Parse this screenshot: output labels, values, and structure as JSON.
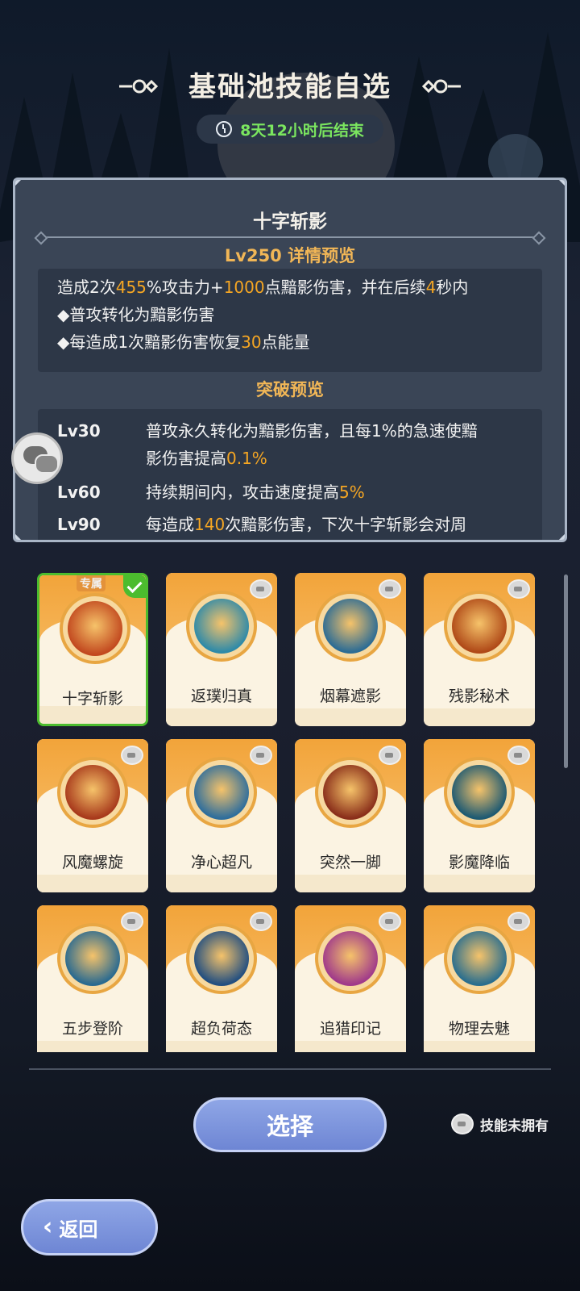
{
  "header": {
    "title": "基础池技能自选",
    "timer": "8天12小时后结束"
  },
  "detail": {
    "skill_name": "十字斩影",
    "preview_title": "Lv250 详情预览",
    "desc": {
      "l1a": "造成2次",
      "l1b": "455",
      "l1c": "%攻击力+",
      "l1d": "1000",
      "l1e": "点黯影伤害，并在后续",
      "l1f": "4",
      "l1g": "秒内",
      "l2": "◆普攻转化为黯影伤害",
      "l3a": "◆每造成1次黯影伤害恢复",
      "l3b": "30",
      "l3c": "点能量"
    },
    "break_title": "突破预览",
    "break": {
      "r1_lv": "Lv30",
      "r1a": "普攻永久转化为黯影伤害，且每1%的急速使黯",
      "r1b": "影伤害提高",
      "r1c": "0.1%",
      "r2_lv": "Lv60",
      "r2a": "持续期间内，攻击速度提高",
      "r2b": "5%",
      "r3_lv": "Lv90",
      "r3a": "每造成",
      "r3b": "140",
      "r3c": "次黯影伤害，下次十字斩影会对周"
    }
  },
  "cards": [
    {
      "label": "十字斩影",
      "icon": "cross-slash-icon",
      "color": "#c2491f",
      "tag": "专属"
    },
    {
      "label": "返璞归真",
      "icon": "golden-figure-icon",
      "color": "#2f8aa8"
    },
    {
      "label": "烟幕遮影",
      "icon": "smoke-burst-icon",
      "color": "#2d6c94"
    },
    {
      "label": "残影秘术",
      "icon": "shadow-figure-icon",
      "color": "#b04a18"
    },
    {
      "label": "风魔螺旋",
      "icon": "spiral-icon",
      "color": "#a83a1c"
    },
    {
      "label": "净心超凡",
      "icon": "meditation-icon",
      "color": "#2f6e9c"
    },
    {
      "label": "突然一脚",
      "icon": "kick-icon",
      "color": "#8a2f1a"
    },
    {
      "label": "影魔降临",
      "icon": "demon-eyes-icon",
      "color": "#1e5a72"
    },
    {
      "label": "五步登阶",
      "icon": "ascend-icon",
      "color": "#2a6a90"
    },
    {
      "label": "超负荷态",
      "icon": "overload-icon",
      "color": "#234f80"
    },
    {
      "label": "追猎印记",
      "icon": "crosshair-icon",
      "color": "#a03a8a"
    },
    {
      "label": "物理去魅",
      "icon": "shield-break-icon",
      "color": "#2a6e8e"
    }
  ],
  "footer": {
    "select_label": "选择",
    "legend_label": "技能未拥有",
    "back_label": "返回"
  }
}
